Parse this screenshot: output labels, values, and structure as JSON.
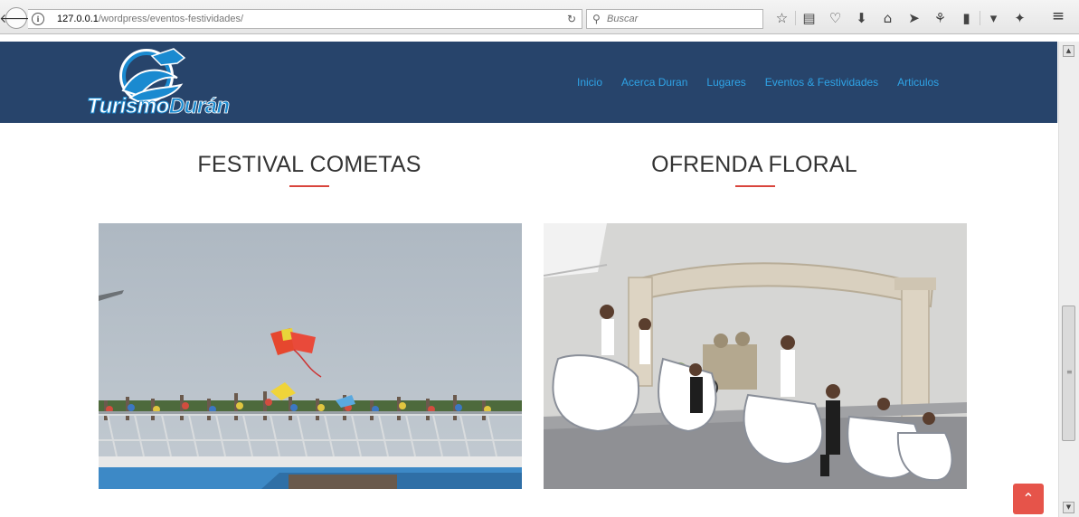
{
  "browser": {
    "url_host": "127.0.0.1",
    "url_path": "/wordpress/eventos-festividades/",
    "search_placeholder": "Buscar"
  },
  "site": {
    "logo_text_1": "Turismo",
    "logo_text_2": "Durán",
    "nav": [
      "Inicio",
      "Acerca Duran",
      "Lugares",
      "Eventos & Festividades",
      "Articulos"
    ],
    "colors": {
      "header_bg": "#27446b",
      "nav_link": "#2fa4e7",
      "accent": "#d9453c",
      "back_to_top": "#e6544a"
    }
  },
  "events": [
    {
      "title": "FESTIVAL COMETAS"
    },
    {
      "title": "OFRENDA FLORAL"
    }
  ],
  "icons": {
    "back": "arrow-left-icon",
    "info": "info-icon",
    "reload": "reload-icon",
    "search": "search-icon",
    "toolbar": [
      "star-icon",
      "reading-list-icon",
      "pocket-icon",
      "download-icon",
      "home-icon",
      "send-icon",
      "extension-icon",
      "clipboard-icon",
      "dropdown-icon",
      "wing-icon"
    ],
    "menu": "hamburger-menu-icon",
    "back_to_top": "chevron-up-icon"
  },
  "glyphs": {
    "back": "🡐",
    "info": "i",
    "reload": "↻",
    "search": "⚲",
    "toolbar": [
      "☆",
      "▤",
      "♡",
      "⬇",
      "⌂",
      "➤",
      "⚘",
      "▮",
      "▾",
      "✦"
    ],
    "menu": "≡",
    "back_to_top": "⌃",
    "sb_up": "▲",
    "sb_down": "▼",
    "sb_grip": "≡"
  }
}
